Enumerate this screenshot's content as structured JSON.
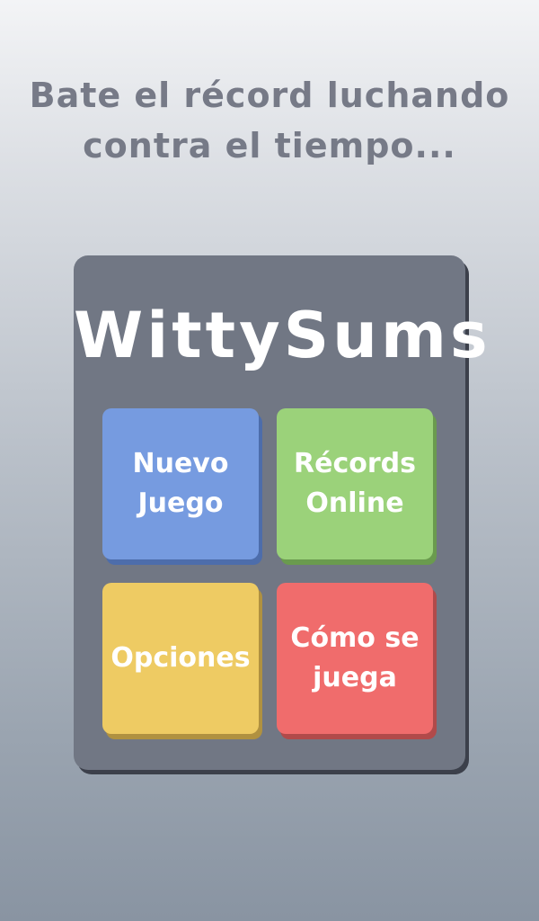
{
  "tagline": {
    "line1": "Bate el récord luchando",
    "line2": "contra el tiempo..."
  },
  "logo": {
    "text": "WittySums"
  },
  "menu": {
    "new_game": {
      "line1": "Nuevo",
      "line2": "Juego",
      "color": "#769be0"
    },
    "records": {
      "line1": "Récords",
      "line2": "Online",
      "color": "#9bd27a"
    },
    "options": {
      "line1": "Opciones",
      "color": "#eecb63"
    },
    "how_to": {
      "line1": "Cómo se",
      "line2": "juega",
      "color": "#f06c6c"
    }
  },
  "colors": {
    "panel": "#717784",
    "text_muted": "#6b6f7d"
  }
}
